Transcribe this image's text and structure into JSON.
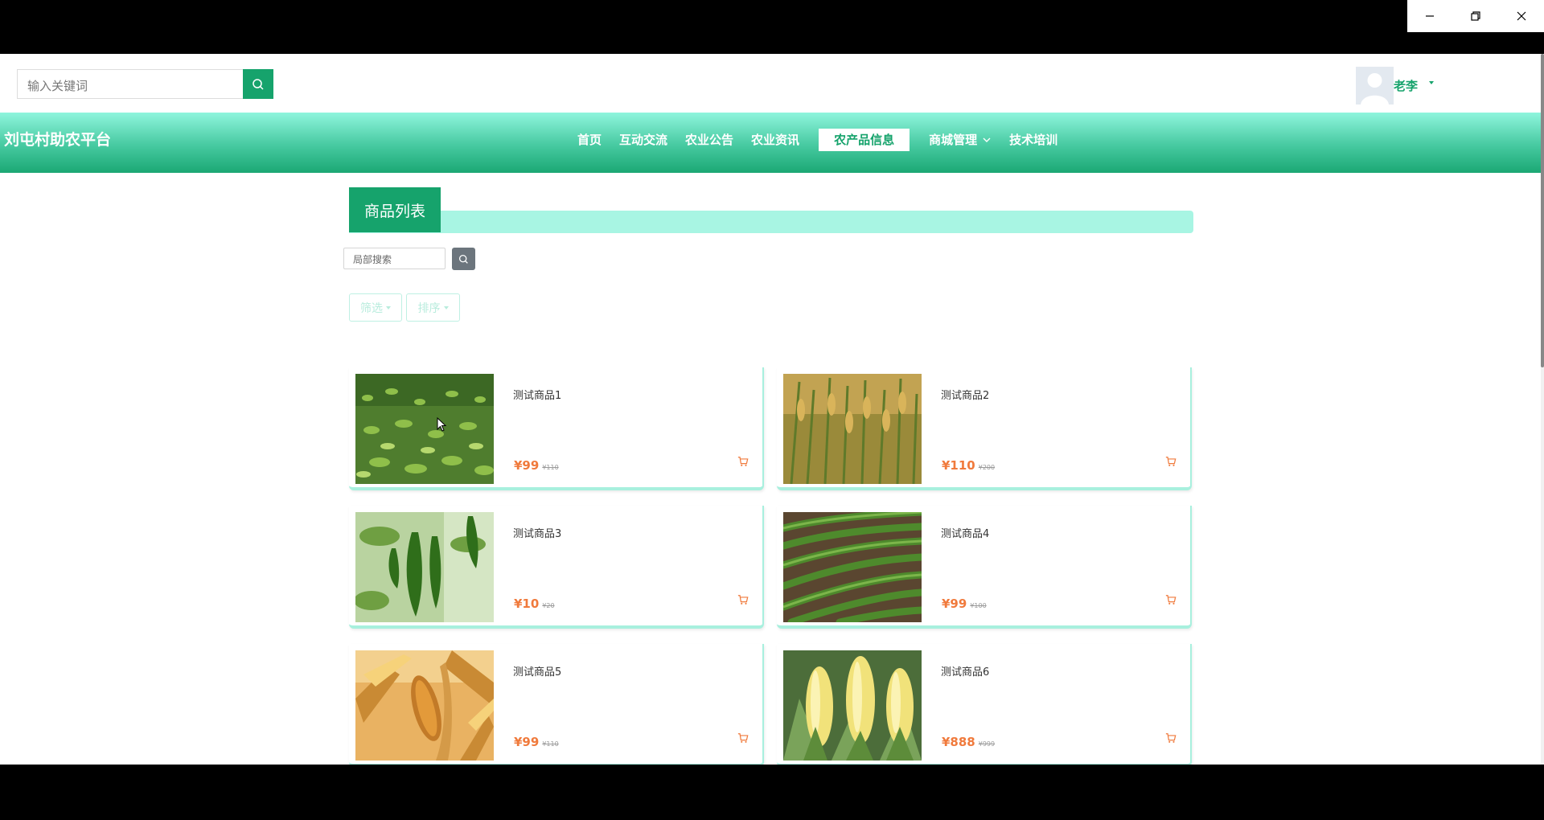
{
  "window": {
    "minimize": "minimize",
    "restore": "restore",
    "close": "close"
  },
  "header": {
    "search_placeholder": "输入关键词",
    "username": "老李"
  },
  "brand": "刘屯村助农平台",
  "nav": {
    "items": [
      {
        "label": "首页"
      },
      {
        "label": "互动交流"
      },
      {
        "label": "农业公告"
      },
      {
        "label": "农业资讯"
      },
      {
        "label": "农产品信息",
        "active": true
      },
      {
        "label": "商城管理",
        "dropdown": true
      },
      {
        "label": "技术培训"
      }
    ]
  },
  "panel": {
    "title": "商品列表",
    "local_search_placeholder": "局部搜索",
    "filter_label": "筛选",
    "sort_label": "排序"
  },
  "products": [
    {
      "name": "测试商品1",
      "price": "¥99",
      "old_price": "¥110",
      "image": "green-plants"
    },
    {
      "name": "测试商品2",
      "price": "¥110",
      "old_price": "¥200",
      "image": "rice-field"
    },
    {
      "name": "测试商品3",
      "price": "¥10",
      "old_price": "¥20",
      "image": "green-peppers"
    },
    {
      "name": "测试商品4",
      "price": "¥99",
      "old_price": "¥100",
      "image": "crop-rows"
    },
    {
      "name": "测试商品5",
      "price": "¥99",
      "old_price": "¥110",
      "image": "corn-stalk"
    },
    {
      "name": "测试商品6",
      "price": "¥888",
      "old_price": "¥999",
      "image": "corn-cobs"
    }
  ],
  "colors": {
    "primary": "#16a36c",
    "accent": "#a8f5e3",
    "price": "#f07a3c"
  }
}
